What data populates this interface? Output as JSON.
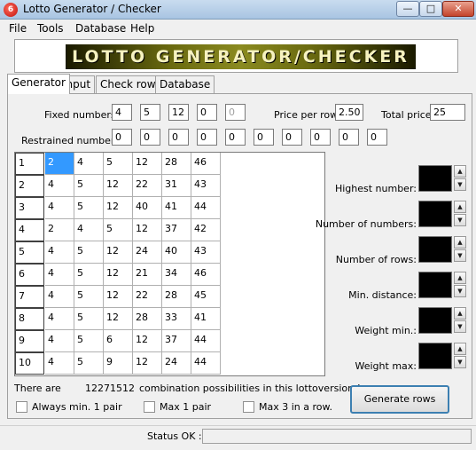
{
  "window": {
    "title": "Lotto Generator / Checker",
    "icon_glyph": "6"
  },
  "menu": [
    "File",
    "Tools",
    "Database",
    "Help"
  ],
  "banner": {
    "text": "LOTTO GENERATOR/CHECKER"
  },
  "tabs": [
    "Generator",
    "Input",
    "Check rows",
    "Database"
  ],
  "fixed": {
    "label": "Fixed numbers:",
    "values": [
      "4",
      "5",
      "12",
      "0",
      "0"
    ]
  },
  "price": {
    "label": "Price per row:",
    "value": "2.50"
  },
  "total": {
    "label": "Total price:",
    "value": "25"
  },
  "restrained": {
    "label": "Restrained numbers:",
    "values": [
      "0",
      "0",
      "0",
      "0",
      "0",
      "0",
      "0",
      "0",
      "0",
      "0"
    ]
  },
  "grid": {
    "rows": [
      [
        "1",
        "2",
        "4",
        "5",
        "12",
        "28",
        "46"
      ],
      [
        "2",
        "4",
        "5",
        "12",
        "22",
        "31",
        "43"
      ],
      [
        "3",
        "4",
        "5",
        "12",
        "40",
        "41",
        "44"
      ],
      [
        "4",
        "2",
        "4",
        "5",
        "12",
        "37",
        "42"
      ],
      [
        "5",
        "4",
        "5",
        "12",
        "24",
        "40",
        "43"
      ],
      [
        "6",
        "4",
        "5",
        "12",
        "21",
        "34",
        "46"
      ],
      [
        "7",
        "4",
        "5",
        "12",
        "22",
        "28",
        "45"
      ],
      [
        "8",
        "4",
        "5",
        "12",
        "28",
        "33",
        "41"
      ],
      [
        "9",
        "4",
        "5",
        "6",
        "12",
        "37",
        "44"
      ],
      [
        "10",
        "4",
        "5",
        "9",
        "12",
        "24",
        "44"
      ]
    ]
  },
  "settings": [
    "Highest number:",
    "Number of numbers:",
    "Number of rows:",
    "Min. distance:",
    "Weight min.:",
    "Weight max:"
  ],
  "combinations": {
    "prefix": "There are",
    "count": "12271512",
    "suffix": "combination possibilities in this lottoversion !."
  },
  "checkboxes": [
    "Always min. 1 pair",
    "Max 1 pair",
    "Max 3 in a row."
  ],
  "generate_label": "Generate rows",
  "status": {
    "label": "Status OK :",
    "value": ""
  },
  "colors": {
    "selection": "#3399ff",
    "banner_text": "#f6f2c0"
  }
}
